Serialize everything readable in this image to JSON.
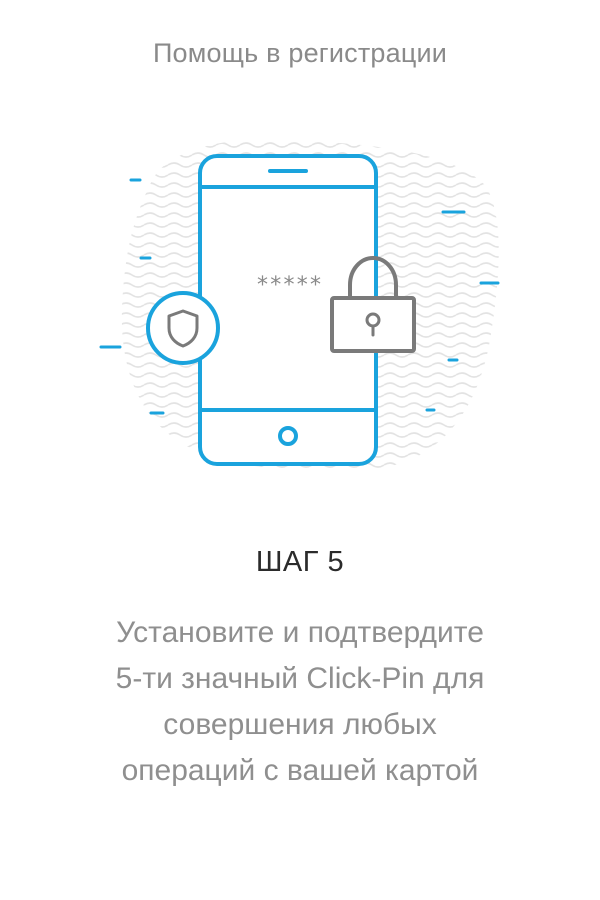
{
  "header": {
    "title": "Помощь в регистрации"
  },
  "illustration": {
    "phone_icon": "smartphone-icon",
    "shield_icon": "shield-icon",
    "lock_icon": "padlock-icon",
    "pin_mask": "*****",
    "colors": {
      "accent": "#1aa3dd",
      "lock": "#7a7a7a",
      "pattern": "#e6e6e6"
    }
  },
  "step": {
    "title": "ШАГ 5",
    "description": "Установите и подтвердите\n5-ти значный Click-Pin для\nсовершения любых\nопераций  с вашей картой"
  }
}
